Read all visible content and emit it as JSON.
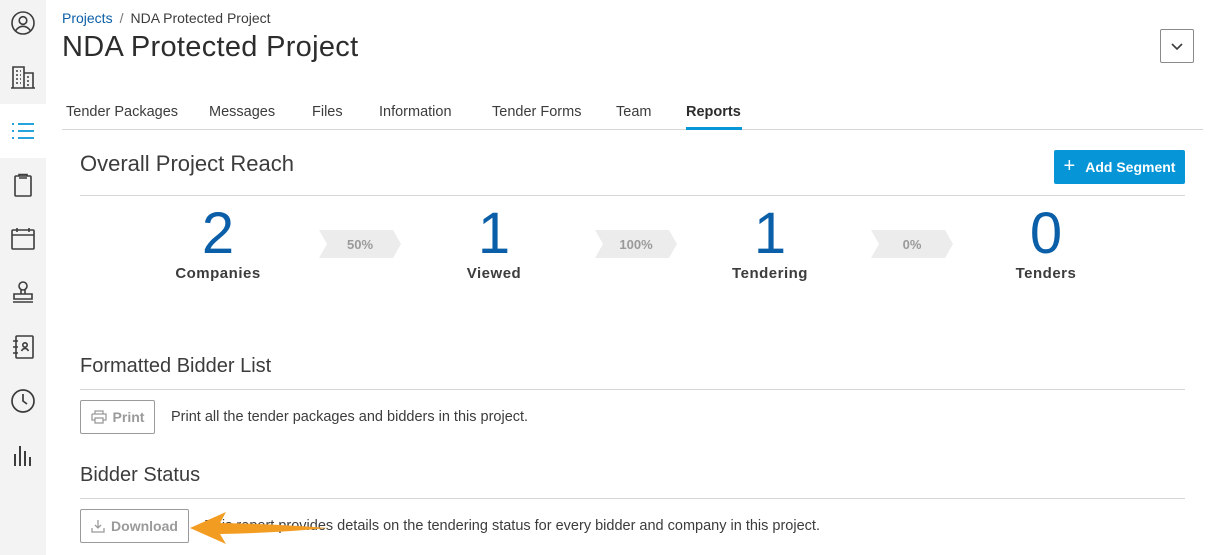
{
  "breadcrumb": {
    "root": "Projects",
    "separator": "/",
    "current": "NDA Protected Project"
  },
  "page": {
    "title": "NDA Protected Project"
  },
  "sidebar": {
    "items": [
      {
        "icon": "user-circle-icon"
      },
      {
        "icon": "building-icon"
      },
      {
        "icon": "list-icon",
        "active": true
      },
      {
        "icon": "clipboard-icon"
      },
      {
        "icon": "calendar-icon"
      },
      {
        "icon": "stamp-icon"
      },
      {
        "icon": "address-book-icon"
      },
      {
        "icon": "clock-icon"
      },
      {
        "icon": "bar-chart-icon"
      }
    ]
  },
  "tabs": [
    {
      "label": "Tender Packages"
    },
    {
      "label": "Messages"
    },
    {
      "label": "Files"
    },
    {
      "label": "Information"
    },
    {
      "label": "Tender Forms"
    },
    {
      "label": "Team"
    },
    {
      "label": "Reports",
      "active": true
    }
  ],
  "reach": {
    "title": "Overall Project Reach",
    "add_segment_label": "Add Segment",
    "stats": [
      {
        "value": "2",
        "label": "Companies"
      },
      {
        "value": "1",
        "label": "Viewed"
      },
      {
        "value": "1",
        "label": "Tendering"
      },
      {
        "value": "0",
        "label": "Tenders"
      }
    ],
    "conversions": [
      "50%",
      "100%",
      "0%"
    ]
  },
  "bidder_list": {
    "title": "Formatted Bidder List",
    "button_label": "Print",
    "description": "Print all the tender packages and bidders in this project."
  },
  "bidder_status": {
    "title": "Bidder Status",
    "button_label": "Download",
    "description": "This report provides details on the tendering status for every bidder and company in this project."
  },
  "colors": {
    "accent": "#0696d7",
    "number": "#0b5fa8",
    "annotation_arrow": "#f39c22"
  }
}
